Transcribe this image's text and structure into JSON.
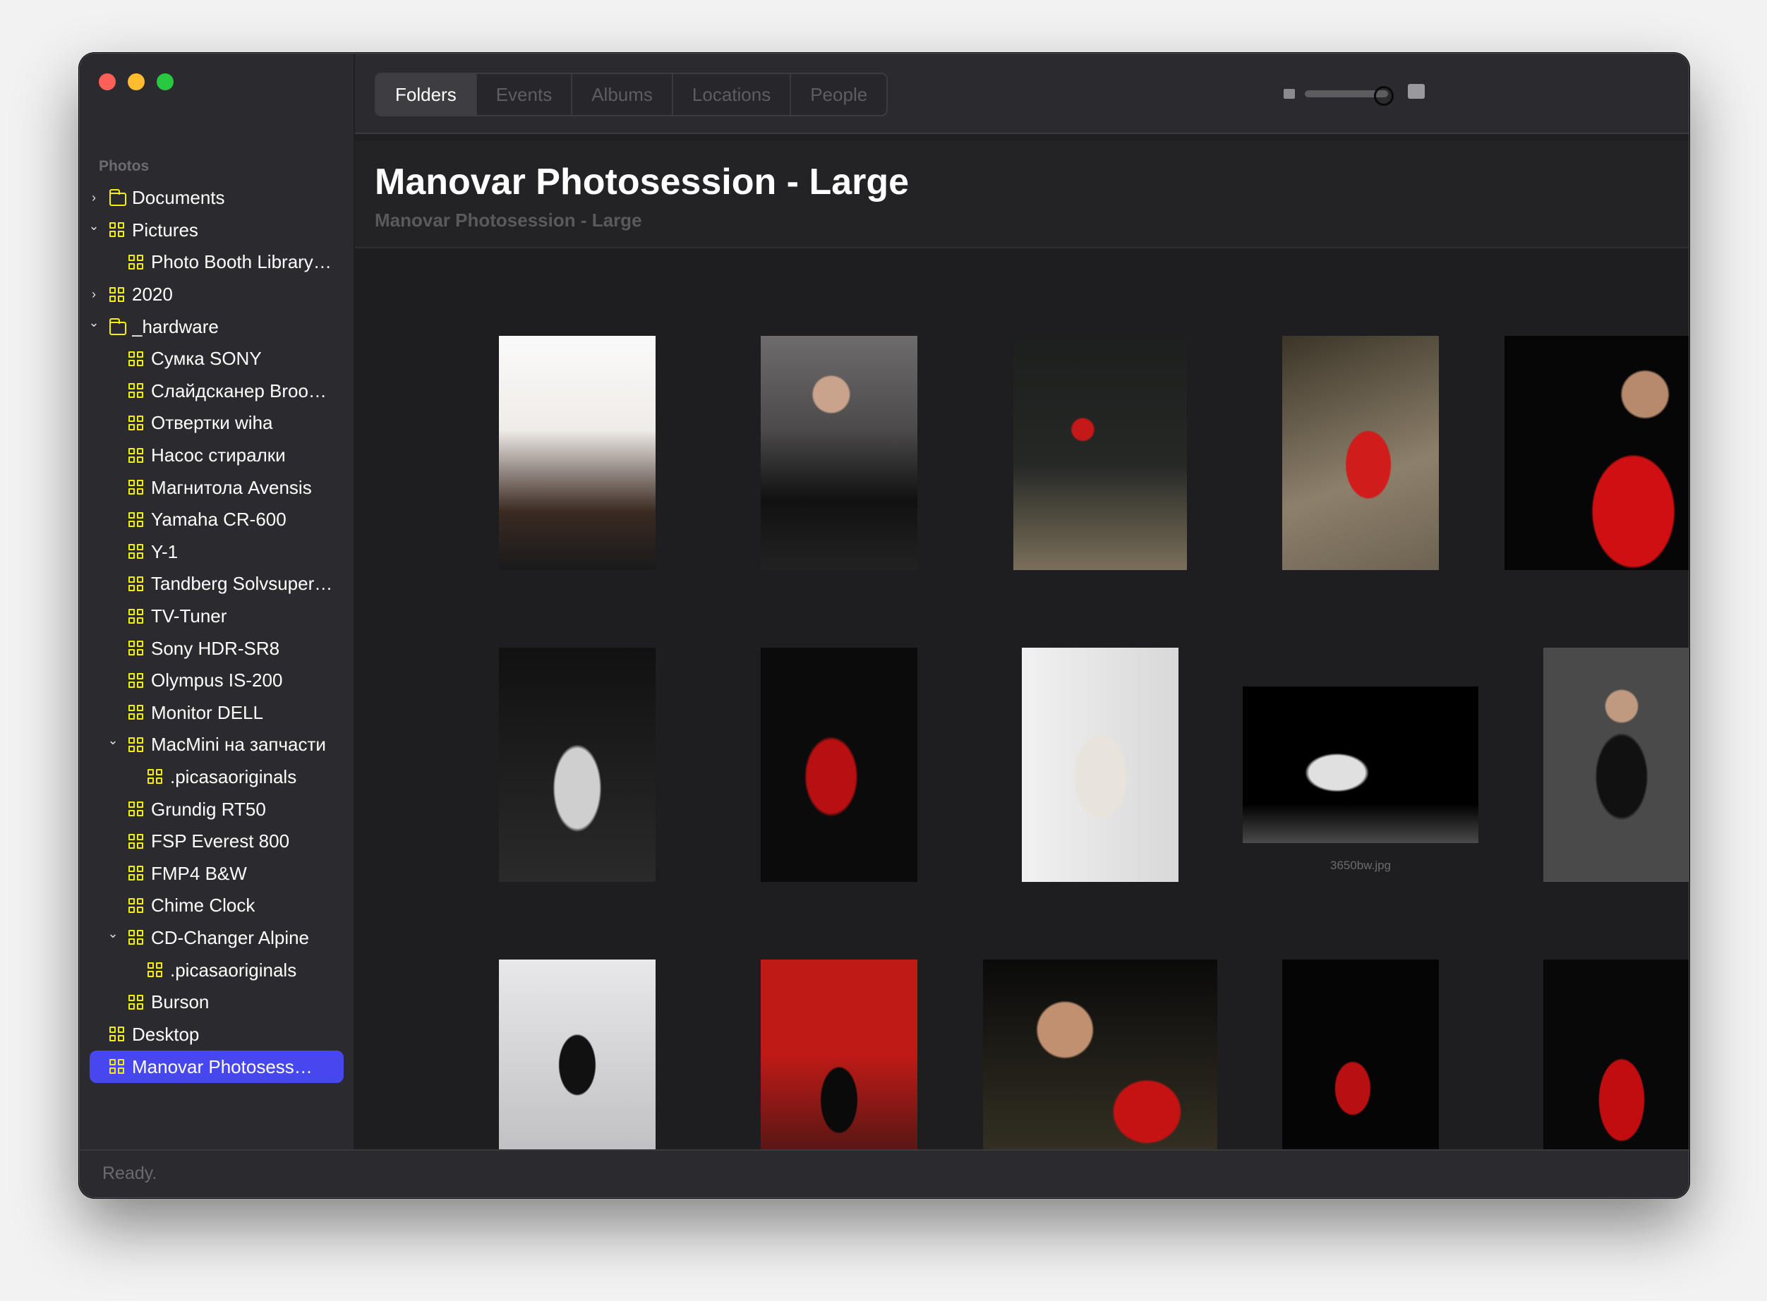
{
  "window": {
    "traffic_lights": {
      "close": "#fe5f57",
      "minimize": "#febc2e",
      "maximize": "#28c840"
    }
  },
  "sidebar": {
    "section_label": "Photos",
    "selected_color": "#4747f0",
    "icon_color": "#f5f000",
    "items": [
      {
        "label": "Documents",
        "icon": "folder-icon",
        "depth": 0,
        "disclosure": "collapsed"
      },
      {
        "label": "Pictures",
        "icon": "grid-icon",
        "depth": 0,
        "disclosure": "expanded"
      },
      {
        "label": "Photo Booth Library …",
        "icon": "grid-icon",
        "depth": 1,
        "disclosure": "none"
      },
      {
        "label": "2020",
        "icon": "grid-icon",
        "depth": 0,
        "disclosure": "collapsed"
      },
      {
        "label": "_hardware",
        "icon": "folder-icon",
        "depth": 0,
        "disclosure": "expanded"
      },
      {
        "label": "Сумка SONY",
        "icon": "grid-icon",
        "depth": 1,
        "disclosure": "none"
      },
      {
        "label": "Слайдсканер Broo…",
        "icon": "grid-icon",
        "depth": 1,
        "disclosure": "none"
      },
      {
        "label": "Отвертки wiha",
        "icon": "grid-icon",
        "depth": 1,
        "disclosure": "none"
      },
      {
        "label": "Насос стиралки",
        "icon": "grid-icon",
        "depth": 1,
        "disclosure": "none"
      },
      {
        "label": "Магнитола Avensis",
        "icon": "grid-icon",
        "depth": 1,
        "disclosure": "none"
      },
      {
        "label": "Yamaha CR-600",
        "icon": "grid-icon",
        "depth": 1,
        "disclosure": "none"
      },
      {
        "label": "Y-1",
        "icon": "grid-icon",
        "depth": 1,
        "disclosure": "none"
      },
      {
        "label": "Tandberg Solvsuper…",
        "icon": "grid-icon",
        "depth": 1,
        "disclosure": "none"
      },
      {
        "label": "TV-Tuner",
        "icon": "grid-icon",
        "depth": 1,
        "disclosure": "none"
      },
      {
        "label": "Sony HDR-SR8",
        "icon": "grid-icon",
        "depth": 1,
        "disclosure": "none"
      },
      {
        "label": "Olympus IS-200",
        "icon": "grid-icon",
        "depth": 1,
        "disclosure": "none"
      },
      {
        "label": "Monitor DELL",
        "icon": "grid-icon",
        "depth": 1,
        "disclosure": "none"
      },
      {
        "label": "MacMini на запчасти",
        "icon": "grid-icon",
        "depth": 1,
        "disclosure": "expanded"
      },
      {
        "label": ".picasaoriginals",
        "icon": "grid-icon",
        "depth": 2,
        "disclosure": "none"
      },
      {
        "label": "Grundig RT50",
        "icon": "grid-icon",
        "depth": 1,
        "disclosure": "none"
      },
      {
        "label": "FSP Everest 800",
        "icon": "grid-icon",
        "depth": 1,
        "disclosure": "none"
      },
      {
        "label": "FMP4 B&W",
        "icon": "grid-icon",
        "depth": 1,
        "disclosure": "none"
      },
      {
        "label": "Chime Clock",
        "icon": "grid-icon",
        "depth": 1,
        "disclosure": "none"
      },
      {
        "label": "CD-Changer Alpine",
        "icon": "grid-icon",
        "depth": 1,
        "disclosure": "expanded"
      },
      {
        "label": ".picasaoriginals",
        "icon": "grid-icon",
        "depth": 2,
        "disclosure": "none"
      },
      {
        "label": "Burson",
        "icon": "grid-icon",
        "depth": 1,
        "disclosure": "none"
      },
      {
        "label": "Desktop",
        "icon": "grid-icon",
        "depth": 0,
        "disclosure": "none"
      },
      {
        "label": "Manovar Photosessio…",
        "icon": "grid-icon",
        "depth": 0,
        "disclosure": "none",
        "selected": true
      }
    ]
  },
  "toolbar": {
    "tabs": [
      {
        "label": "Folders",
        "active": true
      },
      {
        "label": "Events",
        "active": false
      },
      {
        "label": "Albums",
        "active": false
      },
      {
        "label": "Locations",
        "active": false
      },
      {
        "label": "People",
        "active": false
      }
    ],
    "thumbnail_size_slider": {
      "value": 0.92,
      "min_icon": "small-image-icon",
      "max_icon": "large-image-icon"
    }
  },
  "header": {
    "title": "Manovar Photosession - Large",
    "subtitle": "Manovar Photosession - Large"
  },
  "grid": {
    "photos": [
      {
        "orientation": "portrait",
        "desc": "girl with glasses and pigtails, white background",
        "caption": ""
      },
      {
        "orientation": "portrait",
        "desc": "woman with glasses on phone, black blouse, grey background",
        "caption": ""
      },
      {
        "orientation": "portrait",
        "desc": "woman on stool with red ribbons",
        "caption": ""
      },
      {
        "orientation": "portrait",
        "desc": "woman in red dress lying on floor",
        "caption": ""
      },
      {
        "orientation": "square",
        "desc": "woman in red dress, dark background",
        "caption": ""
      },
      {
        "orientation": "portrait",
        "desc": "black and white portrait, woman in tank top",
        "caption": ""
      },
      {
        "orientation": "portrait",
        "desc": "woman in red dress, arms raised",
        "caption": ""
      },
      {
        "orientation": "portrait",
        "desc": "woman in white lace dress",
        "caption": ""
      },
      {
        "orientation": "landscape",
        "desc": "black and white, woman in white shirt sitting",
        "caption": "3650bw.jpg"
      },
      {
        "orientation": "portrait",
        "desc": "woman in black top, grey background",
        "caption": ""
      },
      {
        "orientation": "portrait",
        "desc": "girl in black dress and striped stockings",
        "caption": ""
      },
      {
        "orientation": "portrait",
        "desc": "woman sitting on tiled floor, red background",
        "caption": ""
      },
      {
        "orientation": "square",
        "desc": "woman in red lying on floor, close-up",
        "caption": ""
      },
      {
        "orientation": "portrait",
        "desc": "woman in long red dress standing",
        "caption": ""
      },
      {
        "orientation": "portrait",
        "desc": "woman in red dress, black gloves",
        "caption": ""
      }
    ]
  },
  "status": {
    "text": "Ready."
  }
}
